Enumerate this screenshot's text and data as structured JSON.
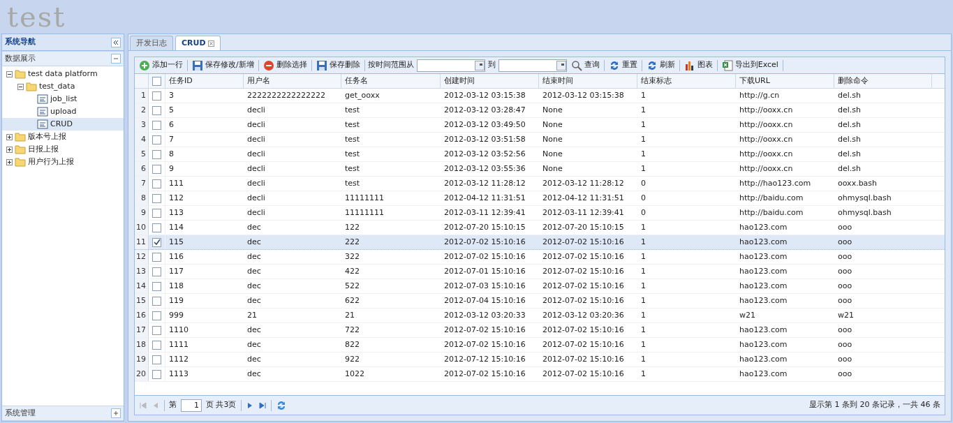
{
  "header": {
    "title": "test"
  },
  "sidebar": {
    "title": "系统导航",
    "sections": [
      {
        "title": "数据展示",
        "expanded": true
      },
      {
        "title": "系统管理",
        "expanded": false
      }
    ],
    "tree": [
      {
        "label": "test data platform",
        "expanded": true,
        "selected": false,
        "children": [
          {
            "label": "test_data",
            "expanded": true,
            "selected": false,
            "children": [
              {
                "label": "job_list",
                "selected": false
              },
              {
                "label": "upload",
                "selected": false
              },
              {
                "label": "CRUD",
                "selected": true
              }
            ]
          }
        ]
      },
      {
        "label": "版本号上报",
        "expanded": false,
        "selected": false
      },
      {
        "label": "日报上报",
        "expanded": false,
        "selected": false
      },
      {
        "label": "用户行为上报",
        "expanded": false,
        "selected": false
      }
    ]
  },
  "tabs": [
    {
      "label": "开发日志",
      "selected": false,
      "closable": false
    },
    {
      "label": "CRUD",
      "selected": true,
      "closable": true
    }
  ],
  "toolbar": [
    {
      "kind": "button",
      "label": "添加一行"
    },
    {
      "kind": "button",
      "label": "保存修改/新增"
    },
    {
      "kind": "button",
      "label": "删除选择"
    },
    {
      "kind": "button",
      "label": "保存删除"
    },
    {
      "kind": "label",
      "label": "按时间范围从"
    },
    {
      "kind": "date"
    },
    {
      "kind": "label",
      "label": "到"
    },
    {
      "kind": "date"
    },
    {
      "kind": "button",
      "label": "查询"
    },
    {
      "kind": "button",
      "label": "重置"
    },
    {
      "kind": "button",
      "label": "刷新"
    },
    {
      "kind": "button",
      "label": "图表"
    },
    {
      "kind": "button",
      "label": "导出到Excel"
    }
  ],
  "table": {
    "all_checked": false,
    "columns": [
      "任务ID",
      "用户名",
      "任务名",
      "创建时间",
      "结束时间",
      "结束标志",
      "下载URL",
      "删除命令"
    ],
    "rows": [
      {
        "num": "1",
        "checked": false,
        "selected": false,
        "cells": [
          "3",
          "2222222222222222",
          "get_ooxx",
          "2012-03-12 03:15:38",
          "2012-03-12 03:15:38",
          "1",
          "http://g.cn",
          "del.sh"
        ]
      },
      {
        "num": "2",
        "checked": false,
        "selected": false,
        "cells": [
          "5",
          "decli",
          "test",
          "2012-03-12 03:28:47",
          "None",
          "1",
          "http://ooxx.cn",
          "del.sh"
        ]
      },
      {
        "num": "3",
        "checked": false,
        "selected": false,
        "cells": [
          "6",
          "decli",
          "test",
          "2012-03-12 03:49:50",
          "None",
          "1",
          "http://ooxx.cn",
          "del.sh"
        ]
      },
      {
        "num": "4",
        "checked": false,
        "selected": false,
        "cells": [
          "7",
          "decli",
          "test",
          "2012-03-12 03:51:58",
          "None",
          "1",
          "http://ooxx.cn",
          "del.sh"
        ]
      },
      {
        "num": "5",
        "checked": false,
        "selected": false,
        "cells": [
          "8",
          "decli",
          "test",
          "2012-03-12 03:52:56",
          "None",
          "1",
          "http://ooxx.cn",
          "del.sh"
        ]
      },
      {
        "num": "6",
        "checked": false,
        "selected": false,
        "cells": [
          "9",
          "decli",
          "test",
          "2012-03-12 03:55:36",
          "None",
          "1",
          "http://ooxx.cn",
          "del.sh"
        ]
      },
      {
        "num": "7",
        "checked": false,
        "selected": false,
        "cells": [
          "111",
          "decli",
          "test",
          "2012-03-12 11:28:12",
          "2012-03-12 11:28:12",
          "0",
          "http://hao123.com",
          "ooxx.bash"
        ]
      },
      {
        "num": "8",
        "checked": false,
        "selected": false,
        "cells": [
          "112",
          "decli",
          "11111111",
          "2012-04-12 11:31:51",
          "2012-04-12 11:31:51",
          "0",
          "http://baidu.com",
          "ohmysql.bash"
        ]
      },
      {
        "num": "9",
        "checked": false,
        "selected": false,
        "cells": [
          "113",
          "decli",
          "11111111",
          "2012-03-11 12:39:41",
          "2012-03-11 12:39:41",
          "0",
          "http://baidu.com",
          "ohmysql.bash"
        ]
      },
      {
        "num": "10",
        "checked": false,
        "selected": false,
        "cells": [
          "114",
          "dec",
          "122",
          "2012-07-20 15:10:15",
          "2012-07-20 15:10:15",
          "1",
          "hao123.com",
          "ooo"
        ]
      },
      {
        "num": "11",
        "checked": true,
        "selected": true,
        "cells": [
          "115",
          "dec",
          "222",
          "2012-07-02 15:10:16",
          "2012-07-02 15:10:16",
          "1",
          "hao123.com",
          "ooo"
        ]
      },
      {
        "num": "12",
        "checked": false,
        "selected": false,
        "cells": [
          "116",
          "dec",
          "322",
          "2012-07-02 15:10:16",
          "2012-07-02 15:10:16",
          "1",
          "hao123.com",
          "ooo"
        ]
      },
      {
        "num": "13",
        "checked": false,
        "selected": false,
        "cells": [
          "117",
          "dec",
          "422",
          "2012-07-01 15:10:16",
          "2012-07-02 15:10:16",
          "1",
          "hao123.com",
          "ooo"
        ]
      },
      {
        "num": "14",
        "checked": false,
        "selected": false,
        "cells": [
          "118",
          "dec",
          "522",
          "2012-07-03 15:10:16",
          "2012-07-02 15:10:16",
          "1",
          "hao123.com",
          "ooo"
        ]
      },
      {
        "num": "15",
        "checked": false,
        "selected": false,
        "cells": [
          "119",
          "dec",
          "622",
          "2012-07-04 15:10:16",
          "2012-07-02 15:10:16",
          "1",
          "hao123.com",
          "ooo"
        ]
      },
      {
        "num": "16",
        "checked": false,
        "selected": false,
        "cells": [
          "999",
          "21",
          "21",
          "2012-03-12 03:20:33",
          "2012-03-12 03:20:36",
          "1",
          "w21",
          "w21"
        ]
      },
      {
        "num": "17",
        "checked": false,
        "selected": false,
        "cells": [
          "1110",
          "dec",
          "722",
          "2012-07-02 15:10:16",
          "2012-07-02 15:10:16",
          "1",
          "hao123.com",
          "ooo"
        ]
      },
      {
        "num": "18",
        "checked": false,
        "selected": false,
        "cells": [
          "1111",
          "dec",
          "822",
          "2012-07-02 15:10:16",
          "2012-07-02 15:10:16",
          "1",
          "hao123.com",
          "ooo"
        ]
      },
      {
        "num": "19",
        "checked": false,
        "selected": false,
        "cells": [
          "1112",
          "dec",
          "922",
          "2012-07-12 15:10:16",
          "2012-07-02 15:10:16",
          "1",
          "hao123.com",
          "ooo"
        ]
      },
      {
        "num": "20",
        "checked": false,
        "selected": false,
        "cells": [
          "1113",
          "dec",
          "1022",
          "2012-07-02 15:10:16",
          "2012-07-02 15:10:16",
          "1",
          "hao123.com",
          "ooo"
        ]
      }
    ]
  },
  "pager": {
    "page_label": "第",
    "page": "1",
    "total": "页 共3页",
    "info": "显示第 1 条到 20 条记录，一共 46 条"
  }
}
